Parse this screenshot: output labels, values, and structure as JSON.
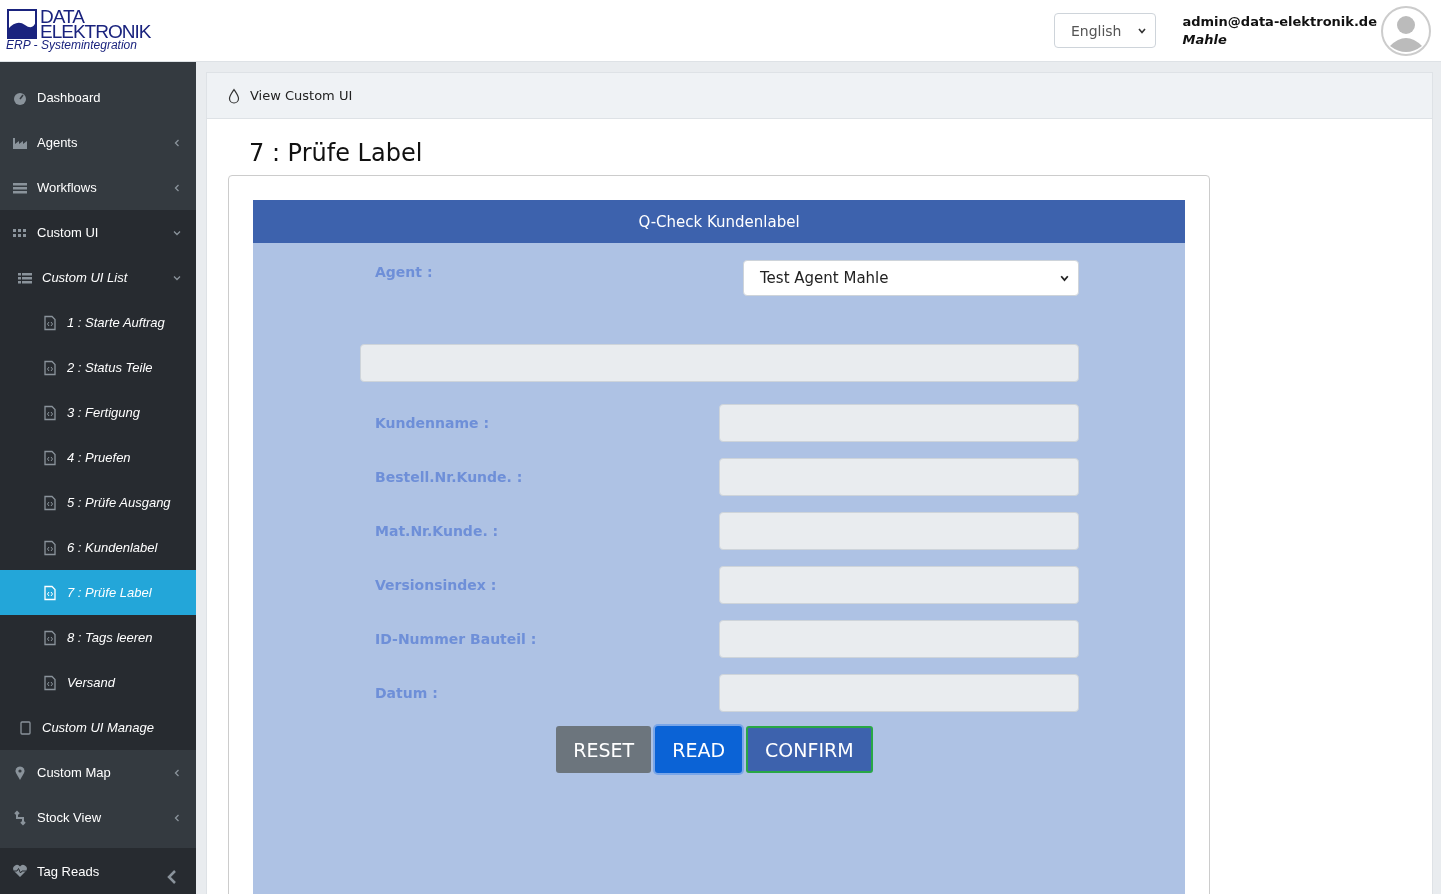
{
  "header": {
    "logo": {
      "line1": "DATA",
      "line2": "ELEKTRONIK",
      "tagline": "ERP - Systemintegration"
    },
    "language": "English",
    "user_email": "admin@data-elektronik.de",
    "user_company": "Mahle"
  },
  "sidebar": {
    "items": [
      {
        "label": "Dashboard",
        "selected": false
      },
      {
        "label": "Agents",
        "expanded": false,
        "selected": false
      },
      {
        "label": "Workflows",
        "expanded": false,
        "selected": false
      },
      {
        "label": "Custom UI",
        "expanded": true,
        "selected": false,
        "children": [
          {
            "label": "Custom UI List",
            "expanded": true,
            "selected": false,
            "children": [
              {
                "label": "1 : Starte Auftrag",
                "selected": false
              },
              {
                "label": "2 : Status Teile",
                "selected": false
              },
              {
                "label": "3 : Fertigung",
                "selected": false
              },
              {
                "label": "4 : Pruefen",
                "selected": false
              },
              {
                "label": "5 : Prüfe Ausgang",
                "selected": false
              },
              {
                "label": "6 : Kundenlabel",
                "selected": false
              },
              {
                "label": "7 : Prüfe Label",
                "selected": true
              },
              {
                "label": "8 : Tags leeren",
                "selected": false
              },
              {
                "label": "Versand",
                "selected": false
              }
            ]
          },
          {
            "label": "Custom UI Manage",
            "selected": false
          }
        ]
      },
      {
        "label": "Custom Map",
        "expanded": false,
        "selected": false
      },
      {
        "label": "Stock View",
        "expanded": false,
        "selected": false
      }
    ],
    "footer_item": "Tag Reads"
  },
  "breadcrumb": "View Custom UI",
  "page_title": "7 : Prüfe Label",
  "form": {
    "title": "Q-Check Kundenlabel",
    "fields": [
      {
        "kind": "select",
        "label": "Agent :",
        "value": "Test Agent Mahle"
      },
      {
        "kind": "wide"
      },
      {
        "kind": "input",
        "label": "Kundenname :"
      },
      {
        "kind": "input",
        "label": "Bestell.Nr.Kunde. :"
      },
      {
        "kind": "input",
        "label": "Mat.Nr.Kunde. :"
      },
      {
        "kind": "input",
        "label": "Versionsindex :"
      },
      {
        "kind": "input",
        "label": "ID-Nummer Bauteil :"
      },
      {
        "kind": "input",
        "label": "Datum :"
      }
    ],
    "buttons": [
      {
        "label": "RESET",
        "kind": "secondary",
        "focused": false
      },
      {
        "label": "READ",
        "kind": "primary",
        "focused": true
      },
      {
        "label": "CONFIRM",
        "kind": "confirm",
        "focused": false
      }
    ]
  }
}
